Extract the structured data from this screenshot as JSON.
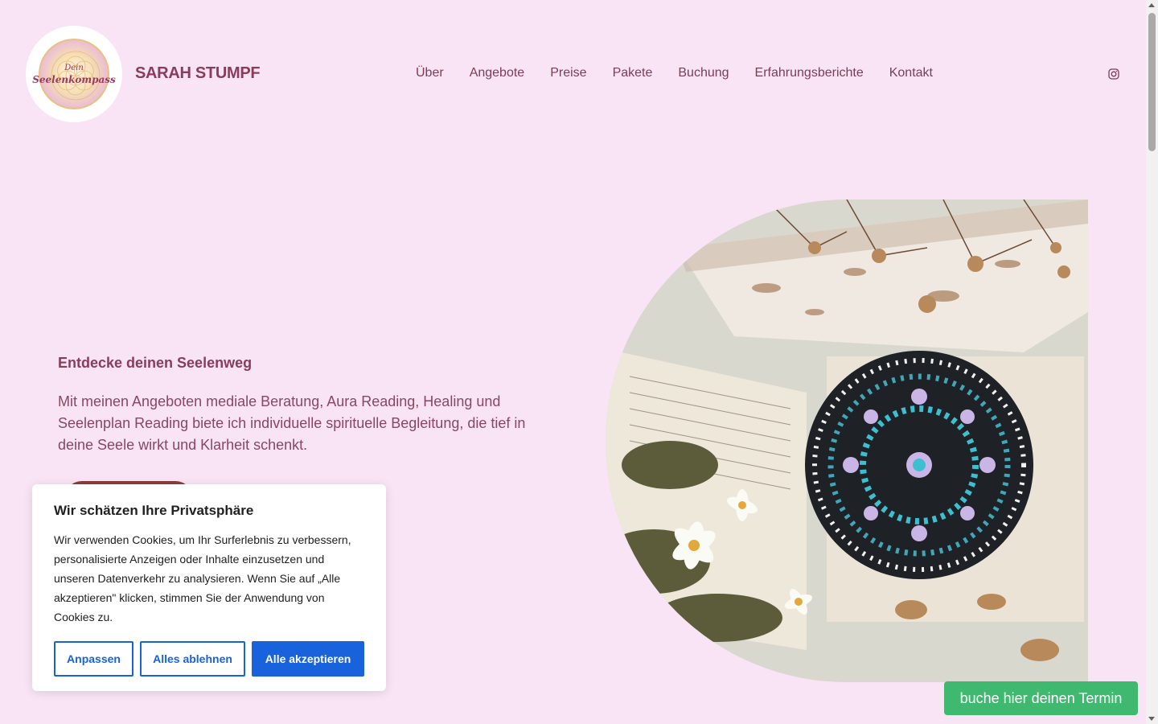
{
  "header": {
    "logo": {
      "line1": "Dein",
      "line2": "Seelenkompass"
    },
    "site_title": "SARAH STUMPF",
    "nav": [
      "Über",
      "Angebote",
      "Preise",
      "Pakete",
      "Buchung",
      "Erfahrungsberichte",
      "Kontakt"
    ],
    "social_icon": "instagram-icon"
  },
  "hero": {
    "heading": "Entdecke deinen Seelenweg",
    "text": "Mit meinen Angeboten mediale Beratung, Aura Reading, Healing und Seelenplan Reading biete ich individuelle spirituelle Begleitung, die tief in deine Seele wirkt und Klarheit schenkt.",
    "image": "mandala-dot-painting-photo"
  },
  "cookie": {
    "title": "Wir schätzen Ihre Privatsphäre",
    "text": "Wir verwenden Cookies, um Ihr Surferlebnis zu verbessern, personalisierte Anzeigen oder Inhalte einzusetzen und unseren Datenverkehr zu analysieren. Wenn Sie auf „Alle akzeptieren\" klicken, stimmen Sie der Anwendung von Cookies zu.",
    "customize": "Anpassen",
    "reject": "Alles ablehnen",
    "accept": "Alle akzeptieren"
  },
  "booking_button": "buche hier deinen Termin",
  "colors": {
    "background": "#f9e4f5",
    "text": "#7a3e55",
    "cookie_primary": "#1863dc",
    "booking_green": "#3fb970"
  }
}
